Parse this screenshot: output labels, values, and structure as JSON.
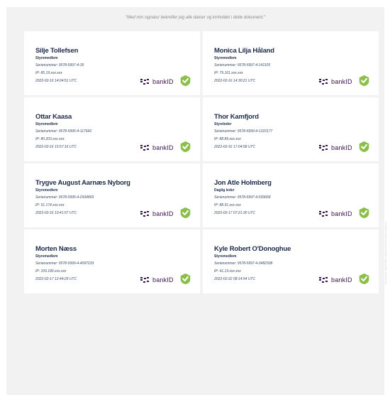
{
  "statement": "\"Med min signatur bekrefter jeg alle datoer og innholdet i dette dokument.\"",
  "provider": {
    "name": "bankID",
    "mark_color": "#39134c",
    "check_color": "#8bbf4a"
  },
  "side_note": "Document ID: 3B1D7 8BF24 6E0C4 9A1D5 Document Signatures",
  "signatures": [
    {
      "name": "Silje Tollefsen",
      "role": "Styremedlem",
      "serial": "Serienummer: 9578-5997-4-35",
      "ip": "IP: 85.19.xxx.xxx",
      "time": "2022-02-16 14:04:51 UTC"
    },
    {
      "name": "Monica Lilja Håland",
      "role": "Styremedlem",
      "serial": "Serienummer: 9578-5997-4-141105",
      "ip": "IP: 79.161.xxx.xxx",
      "time": "2022-02-16 14:30:21 UTC"
    },
    {
      "name": "Ottar Kaasa",
      "role": "Styremedlem",
      "serial": "Serienummer: 9578-5995-4-117660",
      "ip": "IP: 80.203.xxx.xxx",
      "time": "2022-02-16 15:57:16 UTC"
    },
    {
      "name": "Thor Kamfjord",
      "role": "Styreleder",
      "serial": "Serienummer: 9578-5999-4-1310177",
      "ip": "IP: 88.89.xxx.xxx",
      "time": "2022-02-16 17:04:58 UTC"
    },
    {
      "name": "Trygve August Aarnæs Nyborg",
      "role": "Styremedlem",
      "serial": "Serienummer: 9578-5995-4-2934869",
      "ip": "IP: 51.174.xxx.xxx",
      "time": "2022-02-16 19:41:57 UTC"
    },
    {
      "name": "Jon Atle Holmberg",
      "role": "Daglig leder",
      "serial": "Serienummer: 9578-5997-4-593668",
      "ip": "IP: 88.91.xxx.xxx",
      "time": "2022-02-17 07:21:30 UTC"
    },
    {
      "name": "Morten Næss",
      "role": "Styremedlem",
      "serial": "Serienummer: 9578-5999-4-4097233",
      "ip": "IP: 109.189.xxx.xxx",
      "time": "2022-02-17 12:44:29 UTC"
    },
    {
      "name": "Kyle Robert O'Donoghue",
      "role": "Styremedlem",
      "serial": "Serienummer: 9578-5997-4-3482308",
      "ip": "IP: 41.13.xxx.xxx",
      "time": "2022-02-22 08:14:54 UTC"
    }
  ]
}
